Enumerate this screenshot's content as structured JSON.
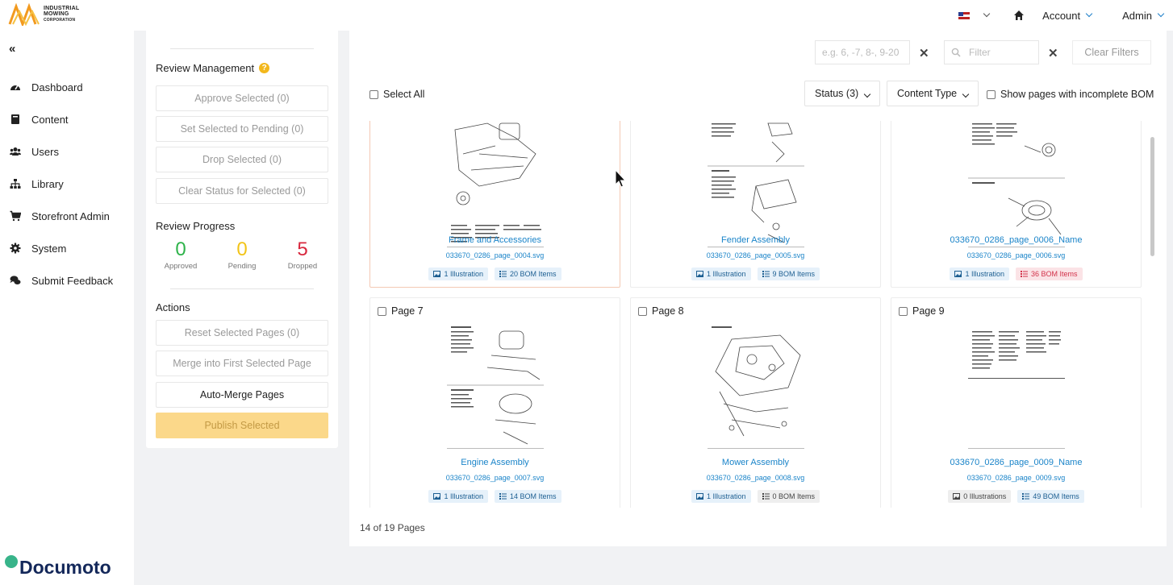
{
  "brand": {
    "logo_line1": "INDUSTRIAL",
    "logo_line2": "MOWING",
    "logo_line3": "CORPORATION",
    "watermark": "Documoto"
  },
  "topnav": {
    "account_label": "Account",
    "admin_label": "Admin"
  },
  "sidebar": {
    "collapse": "«",
    "items": [
      {
        "label": "Dashboard",
        "icon": "gauge-icon"
      },
      {
        "label": "Content",
        "icon": "book-icon"
      },
      {
        "label": "Users",
        "icon": "users-icon"
      },
      {
        "label": "Library",
        "icon": "sitemap-icon"
      },
      {
        "label": "Storefront Admin",
        "icon": "cart-icon"
      },
      {
        "label": "System",
        "icon": "gear-icon"
      },
      {
        "label": "Submit Feedback",
        "icon": "comments-icon"
      }
    ]
  },
  "review": {
    "management_title": "Review Management",
    "approve": "Approve Selected (0)",
    "set_pending": "Set Selected to Pending (0)",
    "drop": "Drop Selected (0)",
    "clear_status": "Clear Status for Selected (0)",
    "progress_title": "Review Progress",
    "approved_count": "0",
    "approved_label": "Approved",
    "pending_count": "0",
    "pending_label": "Pending",
    "dropped_count": "5",
    "dropped_label": "Dropped",
    "actions_title": "Actions",
    "reset": "Reset Selected Pages (0)",
    "merge": "Merge into First Selected Page",
    "auto_merge": "Auto-Merge Pages",
    "publish": "Publish Selected",
    "colors": {
      "approved": "#2eb34a",
      "pending": "#f2c418",
      "dropped": "#d8283e"
    }
  },
  "filters": {
    "range_placeholder": "e.g. 6, -7, 8-, 9-20",
    "filter_placeholder": "Filter",
    "clear": "Clear Filters",
    "clear_x": "✕"
  },
  "toolbar": {
    "select_all": "Select All",
    "status": "Status (3)",
    "content_type": "Content Type",
    "incomplete_bom": "Show pages with incomplete BOM"
  },
  "cards": [
    {
      "page": "",
      "title": "Frame and Accessories",
      "file": "033670_0286_page_0004.svg",
      "illus": "1 Illustration",
      "illus_style": "blue",
      "bom": "20 BOM Items",
      "bom_style": "blue"
    },
    {
      "page": "",
      "title": "Fender Assembly",
      "file": "033670_0286_page_0005.svg",
      "illus": "1 Illustration",
      "illus_style": "blue",
      "bom": "9 BOM Items",
      "bom_style": "blue"
    },
    {
      "page": "",
      "title": "033670_0286_page_0006_Name",
      "file": "033670_0286_page_0006.svg",
      "illus": "1 Illustration",
      "illus_style": "blue",
      "bom": "36 BOM Items",
      "bom_style": "red"
    },
    {
      "page": "Page 7",
      "title": "Engine Assembly",
      "file": "033670_0286_page_0007.svg",
      "illus": "1 Illustration",
      "illus_style": "blue",
      "bom": "14 BOM Items",
      "bom_style": "blue"
    },
    {
      "page": "Page 8",
      "title": "Mower Assembly",
      "file": "033670_0286_page_0008.svg",
      "illus": "1 Illustration",
      "illus_style": "blue",
      "bom": "0 BOM Items",
      "bom_style": "grey"
    },
    {
      "page": "Page 9",
      "title": "033670_0286_page_0009_Name",
      "file": "033670_0286_page_0009.svg",
      "illus": "0 Illustrations",
      "illus_style": "grey",
      "bom": "49 BOM Items",
      "bom_style": "blue"
    }
  ],
  "footer": {
    "page_count": "14 of 19 Pages"
  }
}
